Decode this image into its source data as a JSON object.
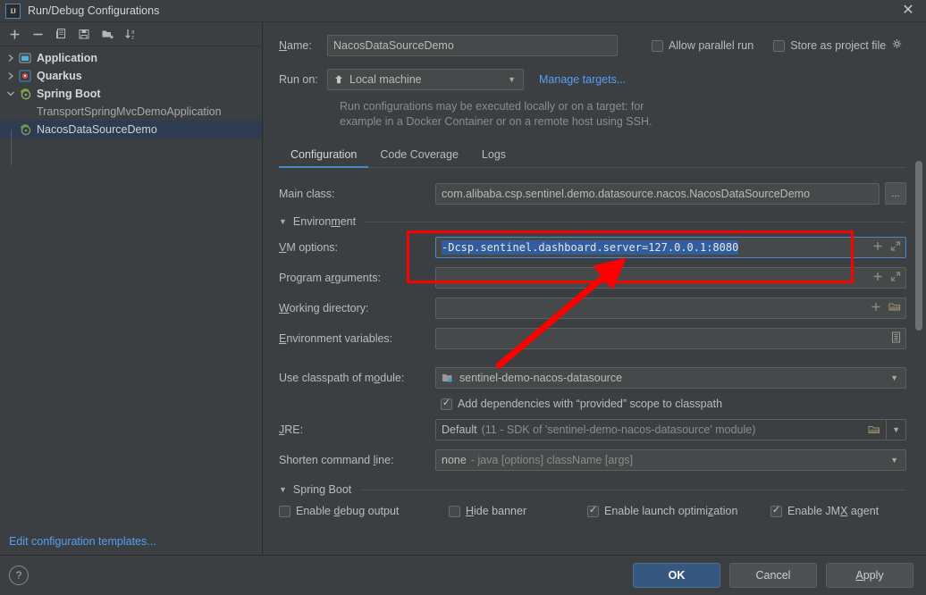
{
  "window": {
    "title": "Run/Debug Configurations",
    "logo_text": "IJ",
    "close_icon": "close-icon"
  },
  "left_panel": {
    "toolbar": [
      {
        "name": "add-configuration-button",
        "icon": "plus-icon"
      },
      {
        "name": "remove-configuration-button",
        "icon": "minus-icon"
      },
      {
        "name": "copy-configuration-button",
        "icon": "copy-icon"
      },
      {
        "name": "save-configuration-button",
        "icon": "save-icon"
      },
      {
        "name": "move-into-folder-button",
        "icon": "folder-add-icon"
      },
      {
        "name": "sort-configurations-button",
        "icon": "sort-az-icon"
      }
    ],
    "tree": [
      {
        "label": "Application",
        "type": "group",
        "expanded": false,
        "twisty": "›",
        "icon": "application-icon"
      },
      {
        "label": "Quarkus",
        "type": "group",
        "expanded": false,
        "twisty": "›",
        "icon": "quarkus-icon"
      },
      {
        "label": "Spring Boot",
        "type": "group",
        "expanded": true,
        "twisty": "⌄",
        "icon": "spring-boot-icon"
      },
      {
        "label": "TransportSpringMvcDemoApplication",
        "type": "child",
        "selected": false,
        "icon": ""
      },
      {
        "label": "NacosDataSourceDemo",
        "type": "child",
        "selected": true,
        "icon": "spring-boot-icon"
      }
    ],
    "edit_templates_link": "Edit configuration templates..."
  },
  "form": {
    "name_label": "Name:",
    "name_value": "NacosDataSourceDemo",
    "allow_parallel_run": {
      "label": "Allow parallel run",
      "checked": false
    },
    "store_as_project_file": {
      "label": "Store as project file",
      "checked": false,
      "gear_icon": "gear-icon"
    },
    "run_on_label": "Run on:",
    "run_on_value": "Local machine",
    "run_on_icon": "local-machine-icon",
    "manage_targets_link": "Manage targets...",
    "hint_line1": "Run configurations may be executed locally or on a target: for",
    "hint_line2": "example in a Docker Container or on a remote host using SSH.",
    "tabs": [
      {
        "label": "Configuration",
        "active": true
      },
      {
        "label": "Code Coverage",
        "active": false
      },
      {
        "label": "Logs",
        "active": false
      }
    ],
    "main_class_label": "Main class:",
    "main_class_value": "com.alibaba.csp.sentinel.demo.datasource.nacos.NacosDataSourceDemo",
    "main_class_browse": "...",
    "environment_section_label": "Environment",
    "vm_options_label": "VM options:",
    "vm_options_value": "-Dcsp.sentinel.dashboard.server=127.0.0.1:8080",
    "vm_options_selected": true,
    "program_arguments_label": "Program arguments:",
    "program_arguments_value": "",
    "working_directory_label": "Working directory:",
    "working_directory_value": "",
    "environment_variables_label": "Environment variables:",
    "environment_variables_value": "",
    "use_classpath_label": "Use classpath of module:",
    "use_classpath_value": "sentinel-demo-nacos-datasource",
    "use_classpath_icon": "module-icon",
    "add_provided_scope": {
      "label": "Add dependencies with “provided” scope to classpath",
      "checked": true
    },
    "jre_label": "JRE:",
    "jre_value": "Default",
    "jre_hint": "(11 - SDK of 'sentinel-demo-nacos-datasource' module)",
    "shorten_cmd_label": "Shorten command line:",
    "shorten_cmd_value": "none",
    "shorten_cmd_hint": "- java [options] className [args]",
    "spring_boot_section_label": "Spring Boot",
    "spring_boot_checkboxes": [
      {
        "label": "Enable debug output",
        "checked": false
      },
      {
        "label": "Hide banner",
        "checked": false
      },
      {
        "label": "Enable launch optimization",
        "checked": true
      },
      {
        "label": "Enable JMX agent",
        "checked": true
      }
    ]
  },
  "bottom": {
    "help_label": "?",
    "ok_label": "OK",
    "cancel_label": "Cancel",
    "apply_label": "Apply"
  },
  "annotation": {
    "rect_color": "#fe0000",
    "arrow_color": "#fe0000"
  }
}
